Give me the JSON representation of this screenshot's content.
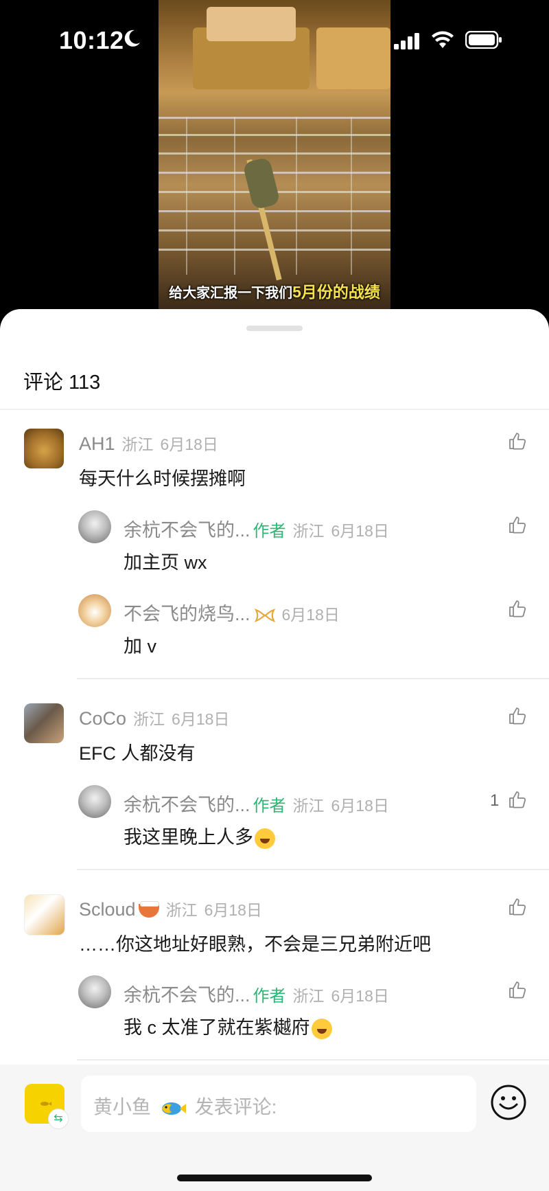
{
  "status_bar": {
    "time": "10:12"
  },
  "video": {
    "caption_prefix": "给大家汇报一下我们",
    "caption_highlight": "5月份的战绩"
  },
  "sheet": {
    "title": "评论 113"
  },
  "comments": [
    {
      "name": "AH1",
      "region": "浙江",
      "date": "6月18日",
      "text": "每天什么时候摆摊啊",
      "replies": [
        {
          "name": "余杭不会飞的...",
          "badge": "作者",
          "region": "浙江",
          "date": "6月18日",
          "text": "加主页 wx"
        },
        {
          "name": "不会飞的烧鸟...",
          "date": "6月18日",
          "text": "加 v"
        }
      ]
    },
    {
      "name": "CoCo",
      "region": "浙江",
      "date": "6月18日",
      "text": "EFC 人都没有",
      "replies": [
        {
          "name": "余杭不会飞的...",
          "badge": "作者",
          "region": "浙江",
          "date": "6月18日",
          "text": "我这里晚上人多",
          "likes": "1"
        }
      ]
    },
    {
      "name": "Scloud",
      "region": "浙江",
      "date": "6月18日",
      "text": "……你这地址好眼熟，不会是三兄弟附近吧",
      "replies": [
        {
          "name": "余杭不会飞的...",
          "badge": "作者",
          "region": "浙江",
          "date": "6月18日",
          "text": "我 c 太准了就在紫樾府"
        }
      ]
    }
  ],
  "footer": {
    "user_name": "黄小鱼",
    "placeholder": "发表评论:",
    "switch_symbol": "⇆"
  },
  "colors": {
    "author_badge": "#2bb673",
    "caption_highlight": "#f6e24a",
    "avatar_yellow": "#f5d200"
  }
}
